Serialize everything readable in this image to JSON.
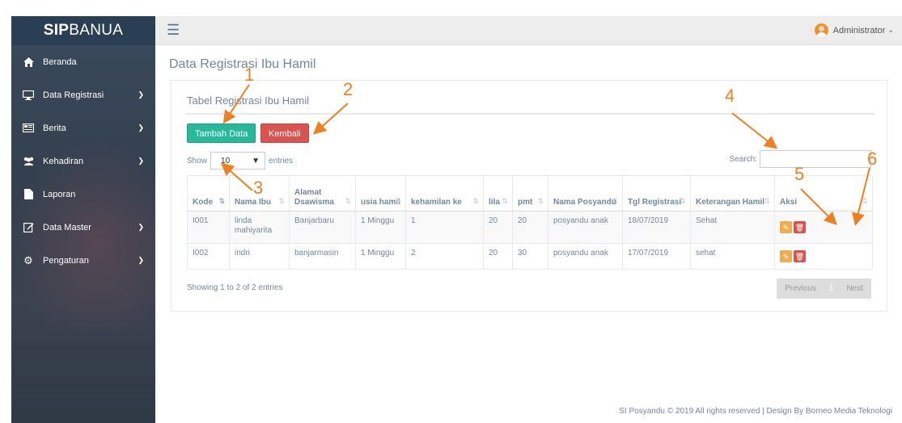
{
  "brand": {
    "bold": "SIP",
    "light": "BANUA"
  },
  "sidebar": {
    "items": [
      {
        "label": "Beranda",
        "icon": "home-icon"
      },
      {
        "label": "Data Registrasi",
        "icon": "desktop-icon"
      },
      {
        "label": "Berita",
        "icon": "newspaper-icon"
      },
      {
        "label": "Kehadiran",
        "icon": "users-icon"
      },
      {
        "label": "Laporan",
        "icon": "file-icon"
      },
      {
        "label": "Data Master",
        "icon": "edit-icon"
      },
      {
        "label": "Pengaturan",
        "icon": "gear-icon"
      }
    ]
  },
  "topbar": {
    "user": "Administrator"
  },
  "page": {
    "title": "Data Registrasi Ibu Hamil"
  },
  "panel": {
    "title": "Tabel Registrasi Ibu Hamil",
    "add_label": "Tambah Data",
    "back_label": "Kembali",
    "show_label": "Show",
    "page_size": "10",
    "entries_label": "entries",
    "search_label": "Search:"
  },
  "table": {
    "headers": [
      "Kode",
      "Nama Ibu",
      "Alamat Dsawisma",
      "usia hamil",
      "kehamilan ke",
      "lila",
      "pmt",
      "Nama Posyandu",
      "Tgl Registrasi",
      "Keterangan Hamil",
      "Aksi"
    ],
    "rows": [
      [
        "I001",
        "linda mahiyarita",
        "Banjarbaru",
        "1 Minggu",
        "1",
        "20",
        "20",
        "posyandu anak",
        "18/07/2019",
        "Sehat"
      ],
      [
        "I002",
        "indri",
        "banjarmasin",
        "1 Minggu",
        "2",
        "20",
        "30",
        "posyandu anak",
        "17/07/2019",
        "sehat"
      ]
    ]
  },
  "info": "Showing 1 to 2 of 2 entries",
  "pager": {
    "previous": "Previous",
    "current": "1",
    "next": "Next"
  },
  "footer": "SI Posyandu © 2019 All rights reserved | Design By Borneo Media Teknologi",
  "annotations": [
    "1",
    "2",
    "3",
    "4",
    "5",
    "6"
  ],
  "colors": {
    "accent_orange": "#f07f1e",
    "add_green": "#26b99a",
    "back_red": "#d9534f",
    "edit_orange": "#f0ad4e",
    "sidebar": "#2a3f54"
  }
}
